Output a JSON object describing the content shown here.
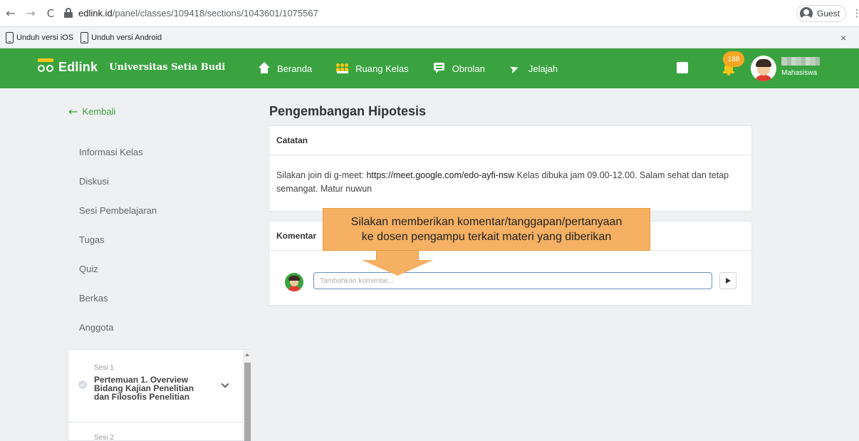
{
  "browser": {
    "url_domain": "edlink.id",
    "url_path": "/panel/classes/109418/sections/1043601/1075567",
    "profile_label": "Guest",
    "back_icon": "←",
    "forward_icon": "→",
    "reload_icon": "C",
    "menu_icon": "⋮"
  },
  "banner": {
    "ios_link": "Unduh versi iOS",
    "android_link": "Unduh versi Android",
    "close_icon": "×"
  },
  "header": {
    "logo_text": "Edlink",
    "university": "Universitas Setia Budi",
    "nav": [
      {
        "label": "Beranda",
        "icon": "home-icon"
      },
      {
        "label": "Ruang Kelas",
        "icon": "classroom-icon"
      },
      {
        "label": "Obrolan",
        "icon": "chat-icon"
      },
      {
        "label": "Jelajah",
        "icon": "rocket-icon"
      }
    ],
    "notification_count": "188",
    "user_role": "Mahasiswa",
    "colors": {
      "primary": "#3aa340",
      "accent": "#f5c518",
      "badge": "#f5a623"
    }
  },
  "sidebar": {
    "back_label": "Kembali",
    "back_icon": "←",
    "menu": [
      "Informasi Kelas",
      "Diskusi",
      "Sesi Pembelajaran",
      "Tugas",
      "Quiz",
      "Berkas",
      "Anggota"
    ],
    "sessions": [
      {
        "label": "Sesi 1",
        "title": "Pertemuan 1. Overview Bidang Kajian Penelitian dan Filosofis Penelitian"
      },
      {
        "label": "Sesi 2",
        "title": ""
      }
    ]
  },
  "main": {
    "title": "Pengembangan Hipotesis",
    "notes": {
      "heading": "Catatan",
      "text_before": "Silakan join di g-meet: ",
      "link": "https://meet.google.com/edo-ayfi-nsw",
      "text_after": " Kelas dibuka jam 09.00-12.00. Salam sehat dan tetap semangat. Matur nuwun"
    },
    "comments": {
      "heading": "Komentar",
      "placeholder": "Tambahkan komentar..."
    }
  },
  "callout": {
    "line1": "Silakan memberikan komentar/tanggapan/pertanyaan",
    "line2": "ke dosen pengampu terkait materi yang diberikan",
    "color": "#f5b063"
  }
}
